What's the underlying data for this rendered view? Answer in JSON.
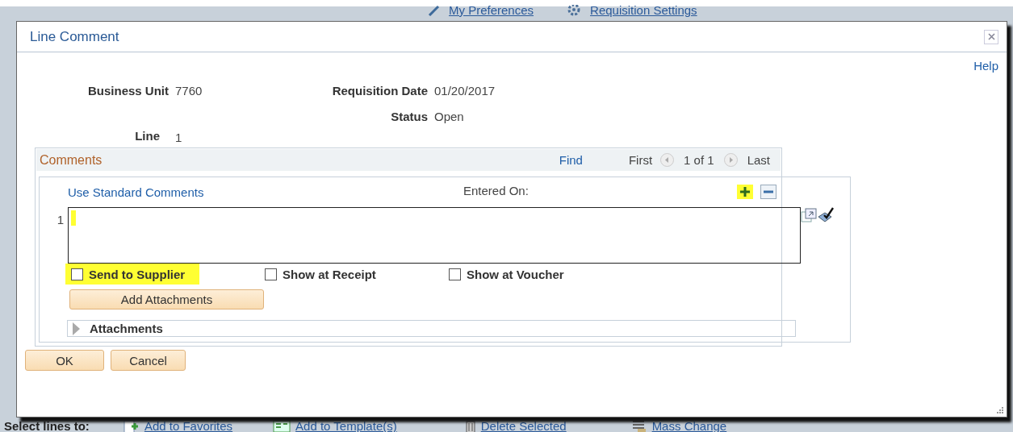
{
  "background": {
    "top_links": [
      {
        "kind": "pencil",
        "label": "My Preferences"
      },
      {
        "kind": "gear",
        "label": "Requisition Settings"
      }
    ],
    "select_label": "Select lines to:",
    "bottom_links": [
      {
        "kind": "favorites",
        "label": "Add to Favorites"
      },
      {
        "kind": "template",
        "label": "Add to Template(s)"
      },
      {
        "kind": "trash",
        "label": "Delete Selected"
      },
      {
        "kind": "mass",
        "label": "Mass Change"
      }
    ]
  },
  "dialog": {
    "title": "Line Comment",
    "help": "Help",
    "fields": [
      {
        "label": "Business Unit",
        "value": "7760"
      },
      {
        "label": "Requisition Date",
        "value": "01/20/2017"
      },
      {
        "label": "Status",
        "value": "Open"
      },
      {
        "label": "Line",
        "value": "1"
      }
    ],
    "comments": {
      "title": "Comments",
      "find": "Find",
      "first": "First",
      "page": "1 of 1",
      "last": "Last",
      "use_standard_comments": "Use Standard Comments",
      "entered_on_label": "Entered On:",
      "add_row_highlighted": true,
      "row": {
        "number": "1",
        "cursor_highlighted": true
      },
      "checkboxes": [
        {
          "label": "Send to Supplier",
          "checked": false,
          "highlighted": true
        },
        {
          "label": "Show at Receipt",
          "checked": false,
          "highlighted": false
        },
        {
          "label": "Show at Voucher",
          "checked": false,
          "highlighted": false
        }
      ],
      "add_attachments": "Add Attachments",
      "attachments": {
        "label": "Attachments",
        "expanded": false
      }
    },
    "buttons": [
      "OK",
      "Cancel"
    ]
  }
}
